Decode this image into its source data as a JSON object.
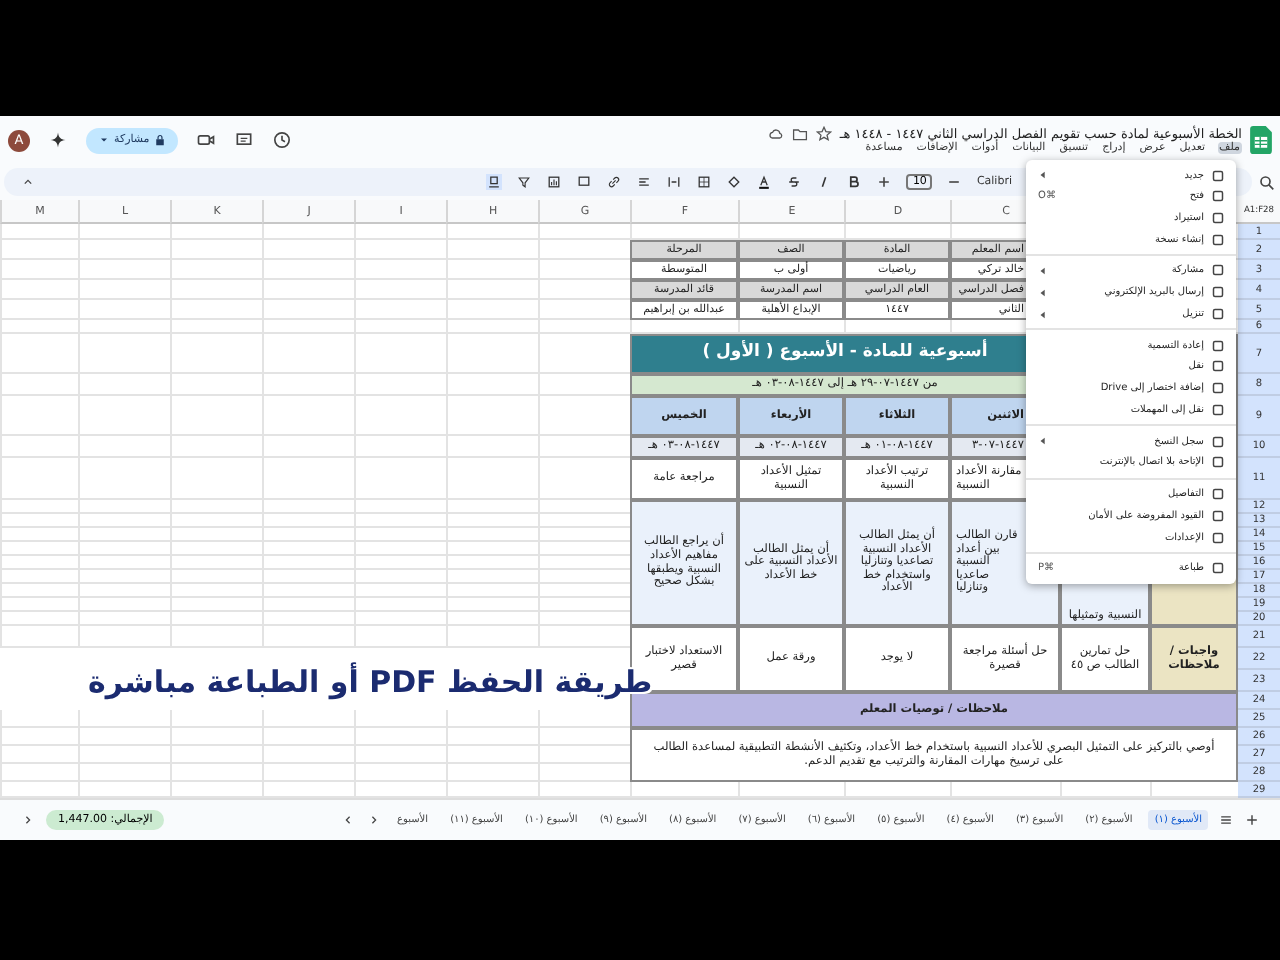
{
  "document": {
    "title": "الخطة الأسبوعية لمادة حسب تقويم الفصل الدراسي الثاني ١٤٤٧ - ١٤٤٨ هـ",
    "menus": [
      {
        "label": "ملف",
        "selected": true
      },
      {
        "label": "تعديل",
        "selected": false
      },
      {
        "label": "عرض",
        "selected": false
      },
      {
        "label": "إدراج",
        "selected": false
      },
      {
        "label": "تنسيق",
        "selected": false
      },
      {
        "label": "البيانات",
        "selected": false
      },
      {
        "label": "أدوات",
        "selected": false
      },
      {
        "label": "الإضافات",
        "selected": false
      },
      {
        "label": "مساعدة",
        "selected": false
      }
    ]
  },
  "account": {
    "avatar": "A",
    "share_button": "مشاركة"
  },
  "toolbar": {
    "name_box": "A1:F28",
    "font": "Calibri",
    "font_size": "10"
  },
  "column_headers": [
    "C",
    "D",
    "E",
    "F",
    "G",
    "H",
    "I",
    "J",
    "K",
    "L",
    "M"
  ],
  "row_numbers": [
    "1",
    "2",
    "3",
    "4",
    "5",
    "6",
    "7",
    "8",
    "9",
    "10",
    "11",
    "12",
    "13",
    "14",
    "15",
    "16",
    "17",
    "18",
    "19",
    "20",
    "21",
    "22",
    "23",
    "24",
    "25",
    "26",
    "27",
    "28",
    "29"
  ],
  "sheet": {
    "info_rows": [
      [
        "اسم المعلم",
        "المادة",
        "الصف",
        "المرحلة"
      ],
      [
        "خالد تركي",
        "رياضيات",
        "أولى ب",
        "المتوسطة"
      ],
      [
        "فصل الدراسي",
        "العام الدراسي",
        "اسم المدرسة",
        "قائد المدرسة"
      ],
      [
        "الثاني",
        "١٤٤٧",
        "الإبداع الأهلية",
        "عبدالله بن إبراهيم"
      ]
    ],
    "title": "أسبوعية للمادة - الأسبوع ( الأول )",
    "date_range": "من ١٤٤٧-٠٧-٢٩ هـ إلى ١٤٤٧-٠٨-٠٣ هـ",
    "days": [
      "الاثنين",
      "الثلاثاء",
      "الأربعاء",
      "الخميس"
    ],
    "dates": [
      "١٤٤٧-٠٧-٣",
      "١٤٤٧-٠٨-٠١ هـ",
      "١٤٤٧-٠٨-٠٢ هـ",
      "١٤٤٧-٠٨-٠٣ هـ"
    ],
    "lessons": [
      "مقارنة الأعداد النسبية",
      "ترتيب الأعداد النسبية",
      "تمثيل الأعداد النسبية",
      "مراجعة عامة"
    ],
    "objectives_partial": "النسبية وتمثيلها",
    "objectives": [
      "قارن الطالب بين أعداد النسبية صاعديا وتنازليا",
      "أن يمثل الطالب الأعداد النسبية تصاعديا وتنازليا واستخدام خط الأعداد",
      "أن يمثل الطالب الأعداد النسبية على خط الأعداد",
      "أن يراجع الطالب مفاهيم الأعداد النسبية ويطبقها بشكل صحيح"
    ],
    "homework_label": "واجبات / ملاحظات",
    "homework": [
      "حل تمارين الطالب ص ٤٥",
      "حل أسئلة مراجعة قصيرة",
      "لا يوجد",
      "ورقة عمل",
      "الاستعداد لاختبار قصير"
    ],
    "notes_heading": "ملاحظات / توصيات المعلم",
    "notes_text": "أوصي بالتركيز على التمثيل البصري للأعداد النسبية باستخدام خط الأعداد، وتكثيف الأنشطة التطبيقية لمساعدة الطالب على ترسيخ مهارات المقارنة والترتيب مع تقديم الدعم."
  },
  "file_menu": {
    "sections": [
      [
        {
          "label": "جديد",
          "submenu": true
        },
        {
          "label": "فتح",
          "shortcut": "⌘O",
          "submenu": false
        },
        {
          "label": "استيراد",
          "submenu": false
        },
        {
          "label": "إنشاء نسخة",
          "submenu": false
        }
      ],
      [
        {
          "label": "مشاركة",
          "submenu": true
        },
        {
          "label": "إرسال بالبريد الإلكتروني",
          "submenu": true
        },
        {
          "label": "تنزيل",
          "submenu": true
        }
      ],
      [
        {
          "label": "إعادة التسمية",
          "submenu": false
        },
        {
          "label": "نقل",
          "submenu": false
        },
        {
          "label": "إضافة اختصار إلى Drive",
          "submenu": false
        },
        {
          "label": "نقل إلى المهملات",
          "submenu": false
        }
      ],
      [
        {
          "label": "سجل النسخ",
          "submenu": true
        },
        {
          "label": "الإتاحة بلا اتصال بالإنترنت",
          "submenu": false
        }
      ],
      [
        {
          "label": "التفاصيل",
          "submenu": false
        },
        {
          "label": "القيود المفروضة على الأمان",
          "submenu": false
        },
        {
          "label": "الإعدادات",
          "submenu": false
        }
      ],
      [
        {
          "label": "طباعة",
          "shortcut": "⌘P",
          "submenu": false
        }
      ]
    ]
  },
  "sheet_tabs": [
    {
      "label": "الأسبوع (١)",
      "selected": true
    },
    {
      "label": "الأسبوع (٢)",
      "selected": false
    },
    {
      "label": "الأسبوع (٣)",
      "selected": false
    },
    {
      "label": "الأسبوع (٤)",
      "selected": false
    },
    {
      "label": "الأسبوع (٥)",
      "selected": false
    },
    {
      "label": "الأسبوع (٦)",
      "selected": false
    },
    {
      "label": "الأسبوع (٧)",
      "selected": false
    },
    {
      "label": "الأسبوع (٨)",
      "selected": false
    },
    {
      "label": "الأسبوع (٩)",
      "selected": false
    },
    {
      "label": "الأسبوع (١٠)",
      "selected": false
    },
    {
      "label": "الأسبوع (١١)",
      "selected": false
    },
    {
      "label": "الأسبوع",
      "selected": false
    }
  ],
  "sum_chip": "الإجمالي: 1,447.00",
  "caption": "طريقة الحفظ PDF أو الطباعة مباشرة"
}
